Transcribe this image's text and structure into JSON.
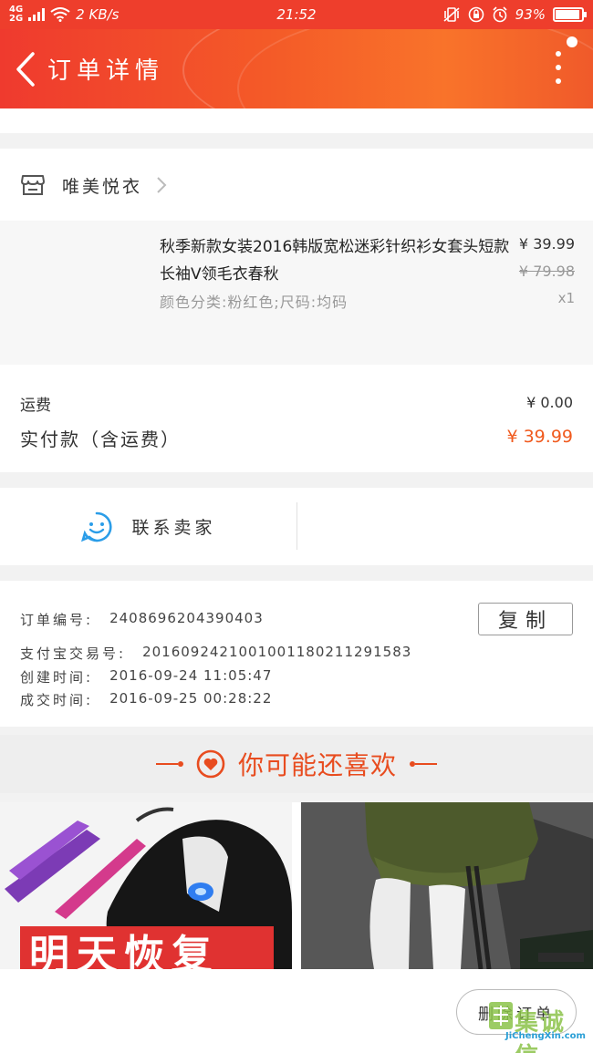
{
  "status_bar": {
    "network": "4G",
    "network2": "2G",
    "speed": "2 KB/s",
    "time": "21:52",
    "battery": "93%",
    "battery_level": 0.93
  },
  "header": {
    "title": "订单详情"
  },
  "shop": {
    "name": "唯美悦衣"
  },
  "item": {
    "title": "秋季新款女装2016韩版宽松迷彩针织衫女套头短款长袖V领毛衣春秋",
    "spec": "颜色分类:粉红色;尺码:均码",
    "price": "¥ 39.99",
    "original_price": "¥ 79.98",
    "quantity": "x1"
  },
  "fees": {
    "shipping_label": "运费",
    "shipping_value": "¥ 0.00",
    "paid_label": "实付款（含运费）",
    "paid_value": "¥ 39.99"
  },
  "contact": {
    "label": "联系卖家"
  },
  "order_info": {
    "order_no_label": "订单编号:",
    "order_no": "2408696204390403",
    "alipay_label": "支付宝交易号:",
    "alipay_no": "2016092421001001180211291583",
    "created_label": "创建时间:",
    "created": "2016-09-24 11:05:47",
    "deal_label": "成交时间:",
    "deal": "2016-09-25 00:28:22",
    "copy_label": "复制"
  },
  "recommend": {
    "title": "你可能还喜欢",
    "banner_text": "明天恢复"
  },
  "bottom": {
    "delete_label": "删除订单"
  },
  "watermark": {
    "logo": "集诚信",
    "url": "JiChengXin.com"
  },
  "colors": {
    "accent": "#f05a1e",
    "header_start": "#ef3a2e",
    "header_end": "#f9732a"
  }
}
